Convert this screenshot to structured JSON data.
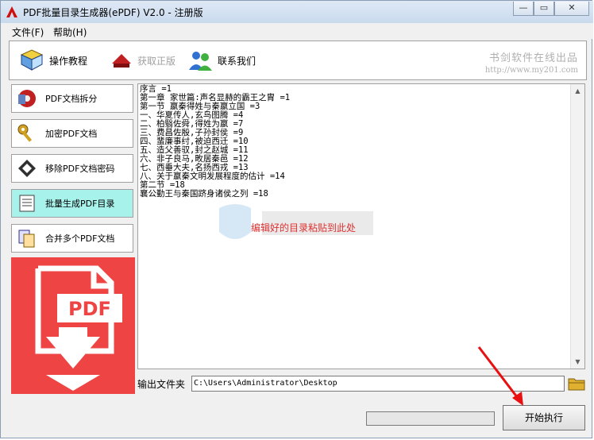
{
  "window": {
    "title": "PDF批量目录生成器(ePDF) V2.0 - 注册版"
  },
  "menu": {
    "file": "文件(F)",
    "help": "帮助(H)"
  },
  "toolbar": {
    "tutorial": "操作教程",
    "get_license": "获取正版",
    "contact": "联系我们",
    "brand_line1": "书剑软件在线出品",
    "brand_line2": "http://www.my201.com"
  },
  "sidebar": {
    "items": [
      {
        "label": "PDF文档拆分"
      },
      {
        "label": "加密PDF文档"
      },
      {
        "label": "移除PDF文档密码"
      },
      {
        "label": "批量生成PDF目录"
      },
      {
        "label": "合并多个PDF文档"
      }
    ],
    "active_index": 3,
    "banner_text": "PDF"
  },
  "editor": {
    "content": "序言 =1\n第一章 家世篇:声名显赫的霸王之胄 =1\n第一节 嬴秦得姓与秦嬴立国 =3\n一、华夏传人,玄鸟图腾 =4\n二、柏翳佐舜,得姓为嬴 =7\n三、费昌佐殷,子孙封侯 =9\n四、蜚廉事纣,被迫西迁 =10\n五、造父善驭,封之赵城 =11\n六、非子良马,畋居秦邑 =12\n七、西垂大夫,名扬西戎 =13\n八、关于嬴秦文明发展程度的估计 =14\n第二节 =18\n襄公勤王与秦国跻身诸侯之列 =18",
    "hint": "编辑好的目录粘贴到此处"
  },
  "output": {
    "label": "输出文件夹",
    "path": "C:\\Users\\Administrator\\Desktop"
  },
  "progress": {
    "fraction": 0.0
  },
  "run_button": "开始执行",
  "colors": {
    "accent": "#a8f2ec",
    "banner": "#ee4444",
    "hint": "#e03030"
  }
}
